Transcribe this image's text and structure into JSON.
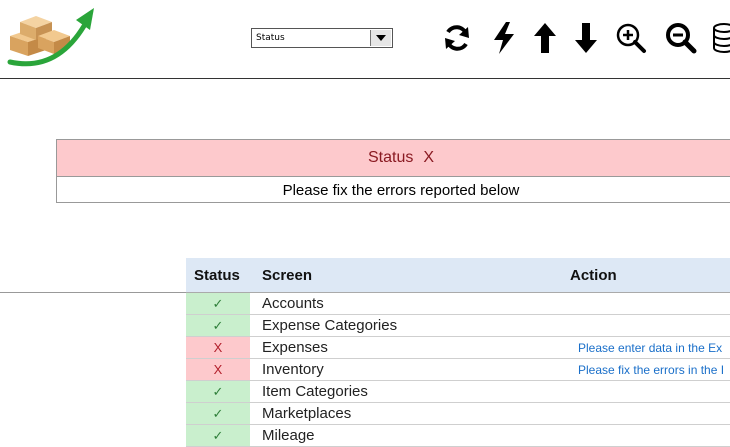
{
  "toolbar": {
    "status_select": {
      "value": "Status"
    },
    "icons": [
      "refresh-icon",
      "lightning-icon",
      "arrow-up-icon",
      "arrow-down-icon",
      "zoom-in-icon",
      "zoom-out-icon",
      "database-icon"
    ]
  },
  "status_panel": {
    "label": "Status",
    "mark": "X",
    "message": "Please fix the errors reported below"
  },
  "table": {
    "headers": {
      "status": "Status",
      "screen": "Screen",
      "action": "Action"
    },
    "rows": [
      {
        "status": "✓",
        "state": "ok",
        "screen": "Accounts",
        "action": ""
      },
      {
        "status": "✓",
        "state": "ok",
        "screen": "Expense Categories",
        "action": ""
      },
      {
        "status": "X",
        "state": "bad",
        "screen": "Expenses",
        "action": "Please enter data in the Ex"
      },
      {
        "status": "X",
        "state": "bad",
        "screen": "Inventory",
        "action": "Please fix the errors in the I"
      },
      {
        "status": "✓",
        "state": "ok",
        "screen": "Item Categories",
        "action": ""
      },
      {
        "status": "✓",
        "state": "ok",
        "screen": "Marketplaces",
        "action": ""
      },
      {
        "status": "✓",
        "state": "ok",
        "screen": "Mileage",
        "action": ""
      }
    ]
  },
  "colors": {
    "ok_bg": "#c9efcd",
    "bad_bg": "#fdc9cc",
    "header_bg": "#dde8f5",
    "link": "#1a6fc9"
  }
}
